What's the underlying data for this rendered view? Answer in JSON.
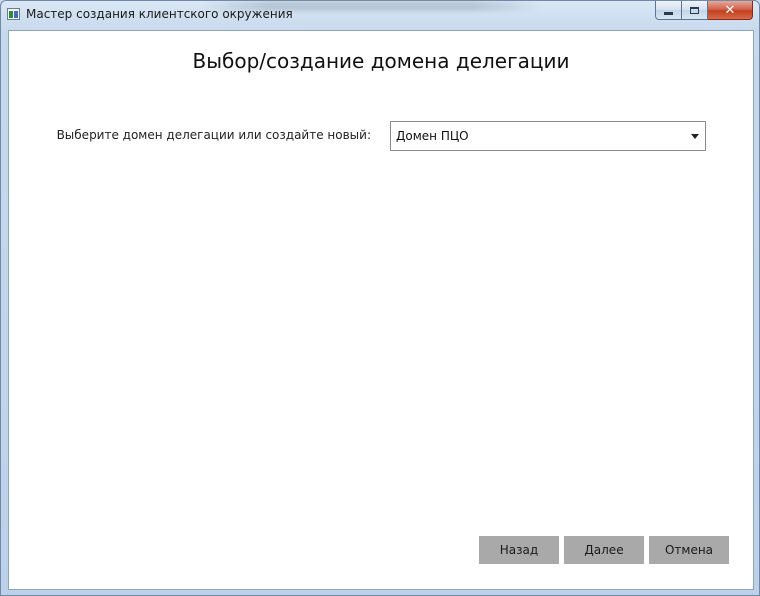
{
  "window": {
    "title": "Мастер создания клиентского окружения",
    "icon": "app-window-icon",
    "controls": {
      "minimize": "minimize-icon",
      "maximize": "maximize-icon",
      "close": "✕"
    }
  },
  "page": {
    "heading": "Выбор/создание домена делегации",
    "domain_label": "Выберите домен делегации или создайте новый:",
    "domain_select": {
      "value": "Домен ПЦО",
      "icon": "chevron-down-icon"
    }
  },
  "buttons": {
    "back": "Назад",
    "next": "Далее",
    "cancel": "Отмена"
  }
}
